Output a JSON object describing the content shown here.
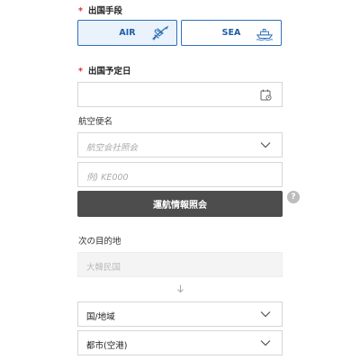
{
  "departure_method": {
    "label": "出国手段",
    "required_mark": "*",
    "options": [
      {
        "label": "AIR",
        "icon": "airplane-icon",
        "selected": true
      },
      {
        "label": "SEA",
        "icon": "ship-icon",
        "selected": false
      }
    ]
  },
  "departure_date": {
    "label": "出国予定日",
    "required_mark": "*",
    "value": "",
    "icon": "calendar-icon"
  },
  "flight": {
    "label": "航空便名",
    "airline_placeholder": "航空会社照会",
    "flight_no_placeholder": "例) KE000",
    "query_button": "運航情報照会",
    "help_mark": "?"
  },
  "destination": {
    "label": "次の目的地",
    "country_disabled": "大韓民国",
    "region_select": "国/地域",
    "city_select": "都市(空港)"
  },
  "colors": {
    "accent": "#2f6fb8",
    "required": "#e03030",
    "button_dark": "#4d4d4d"
  }
}
